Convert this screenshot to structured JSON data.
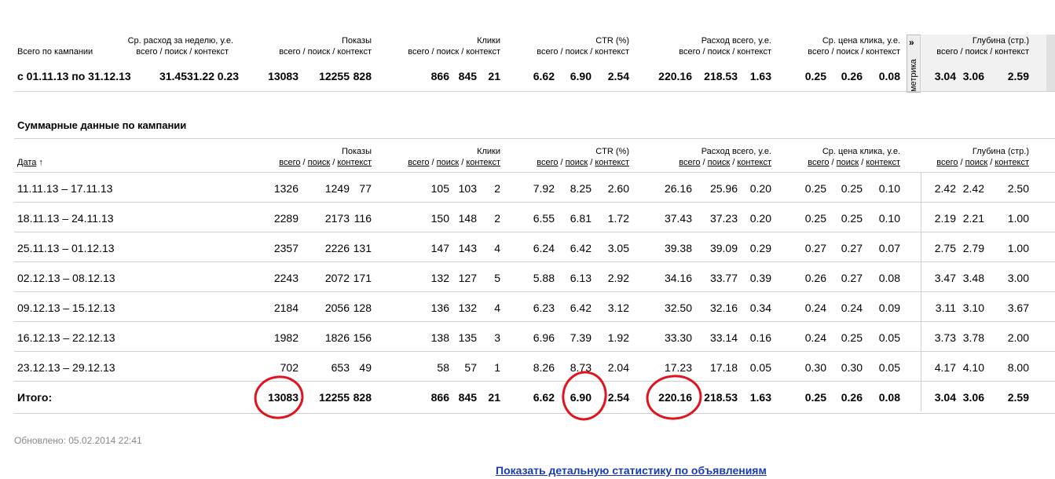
{
  "top_table": {
    "row_header": "Всего по кампании",
    "avg_spend_header_line1": "Ср. расход за неделю, у.е.",
    "avg_spend_header_line2": "всего / поиск / контекст",
    "columns": [
      {
        "title": "Показы",
        "sub": "всего / поиск / контекст"
      },
      {
        "title": "Клики",
        "sub": "всего / поиск / контекст"
      },
      {
        "title": "CTR (%)",
        "sub": "всего / поиск / контекст"
      },
      {
        "title": "Расход всего, у.е.",
        "sub": "всего / поиск / контекст"
      },
      {
        "title": "Ср. цена клика, у.е.",
        "sub": "всего / поиск / контекст"
      },
      {
        "title": "Глубина (стр.)",
        "sub": "всего / поиск / контекст"
      }
    ],
    "metrika_label": "метрика",
    "metrika_arrow": "»",
    "row": {
      "period": "с 01.11.13 по 31.12.13",
      "avg_spend": [
        "31.45",
        "31.22",
        "0.23"
      ],
      "impressions": [
        "13083",
        "12255",
        "828"
      ],
      "clicks": [
        "866",
        "845",
        "21"
      ],
      "ctr": [
        "6.62",
        "6.90",
        "2.54"
      ],
      "spend": [
        "220.16",
        "218.53",
        "1.63"
      ],
      "cpc": [
        "0.25",
        "0.26",
        "0.08"
      ],
      "depth": [
        "3.04",
        "3.06",
        "2.59"
      ]
    }
  },
  "summary": {
    "title": "Суммарные данные по кампании",
    "date_header": "Дата",
    "date_sort_arrow": "↑",
    "sub_all": "всего",
    "sub_search": "поиск",
    "sub_context": "контекст",
    "sep": " / ",
    "columns": [
      "Показы",
      "Клики",
      "CTR (%)",
      "Расход всего, у.е.",
      "Ср. цена клика, у.е.",
      "Глубина (стр.)"
    ],
    "rows": [
      {
        "date": "11.11.13 – 17.11.13",
        "imp": [
          "1326",
          "1249",
          "77"
        ],
        "clk": [
          "105",
          "103",
          "2"
        ],
        "ctr": [
          "7.92",
          "8.25",
          "2.60"
        ],
        "spend": [
          "26.16",
          "25.96",
          "0.20"
        ],
        "cpc": [
          "0.25",
          "0.25",
          "0.10"
        ],
        "depth": [
          "2.42",
          "2.42",
          "2.50"
        ]
      },
      {
        "date": "18.11.13 – 24.11.13",
        "imp": [
          "2289",
          "2173",
          "116"
        ],
        "clk": [
          "150",
          "148",
          "2"
        ],
        "ctr": [
          "6.55",
          "6.81",
          "1.72"
        ],
        "spend": [
          "37.43",
          "37.23",
          "0.20"
        ],
        "cpc": [
          "0.25",
          "0.25",
          "0.10"
        ],
        "depth": [
          "2.19",
          "2.21",
          "1.00"
        ]
      },
      {
        "date": "25.11.13 – 01.12.13",
        "imp": [
          "2357",
          "2226",
          "131"
        ],
        "clk": [
          "147",
          "143",
          "4"
        ],
        "ctr": [
          "6.24",
          "6.42",
          "3.05"
        ],
        "spend": [
          "39.38",
          "39.09",
          "0.29"
        ],
        "cpc": [
          "0.27",
          "0.27",
          "0.07"
        ],
        "depth": [
          "2.75",
          "2.79",
          "1.00"
        ]
      },
      {
        "date": "02.12.13 – 08.12.13",
        "imp": [
          "2243",
          "2072",
          "171"
        ],
        "clk": [
          "132",
          "127",
          "5"
        ],
        "ctr": [
          "5.88",
          "6.13",
          "2.92"
        ],
        "spend": [
          "34.16",
          "33.77",
          "0.39"
        ],
        "cpc": [
          "0.26",
          "0.27",
          "0.08"
        ],
        "depth": [
          "3.47",
          "3.48",
          "3.00"
        ]
      },
      {
        "date": "09.12.13 – 15.12.13",
        "imp": [
          "2184",
          "2056",
          "128"
        ],
        "clk": [
          "136",
          "132",
          "4"
        ],
        "ctr": [
          "6.23",
          "6.42",
          "3.12"
        ],
        "spend": [
          "32.50",
          "32.16",
          "0.34"
        ],
        "cpc": [
          "0.24",
          "0.24",
          "0.09"
        ],
        "depth": [
          "3.11",
          "3.10",
          "3.67"
        ]
      },
      {
        "date": "16.12.13 – 22.12.13",
        "imp": [
          "1982",
          "1826",
          "156"
        ],
        "clk": [
          "138",
          "135",
          "3"
        ],
        "ctr": [
          "6.96",
          "7.39",
          "1.92"
        ],
        "spend": [
          "33.30",
          "33.14",
          "0.16"
        ],
        "cpc": [
          "0.24",
          "0.25",
          "0.05"
        ],
        "depth": [
          "3.73",
          "3.78",
          "2.00"
        ]
      },
      {
        "date": "23.12.13 – 29.12.13",
        "imp": [
          "702",
          "653",
          "49"
        ],
        "clk": [
          "58",
          "57",
          "1"
        ],
        "ctr": [
          "8.26",
          "8.73",
          "2.04"
        ],
        "spend": [
          "17.23",
          "17.18",
          "0.05"
        ],
        "cpc": [
          "0.30",
          "0.30",
          "0.05"
        ],
        "depth": [
          "4.17",
          "4.10",
          "8.00"
        ]
      }
    ],
    "total": {
      "label": "Итого:",
      "imp": [
        "13083",
        "12255",
        "828"
      ],
      "clk": [
        "866",
        "845",
        "21"
      ],
      "ctr": [
        "6.62",
        "6.90",
        "2.54"
      ],
      "spend": [
        "220.16",
        "218.53",
        "1.63"
      ],
      "cpc": [
        "0.25",
        "0.26",
        "0.08"
      ],
      "depth": [
        "3.04",
        "3.06",
        "2.59"
      ]
    }
  },
  "footer": {
    "updated": "Обновлено: 05.02.2014 22:41",
    "detail_link": "Показать детальную статистику по объявлениям"
  },
  "colors": {
    "annotation_circle": "#e0141e",
    "link": "#1a3bb0"
  }
}
